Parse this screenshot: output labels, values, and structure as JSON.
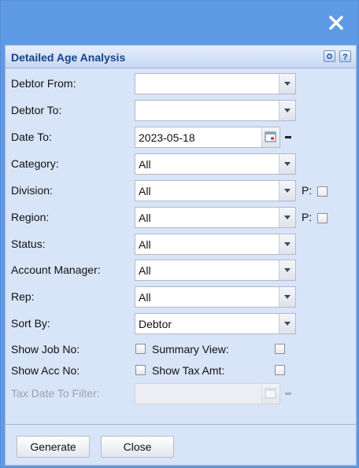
{
  "panel": {
    "title": "Detailed Age Analysis"
  },
  "fields": {
    "debtor_from": {
      "label": "Debtor From:",
      "value": ""
    },
    "debtor_to": {
      "label": "Debtor To:",
      "value": ""
    },
    "date_to": {
      "label": "Date To:",
      "value": "2023-05-18"
    },
    "category": {
      "label": "Category:",
      "value": "All"
    },
    "division": {
      "label": "Division:",
      "value": "All",
      "p_label": "P:"
    },
    "region": {
      "label": "Region:",
      "value": "All",
      "p_label": "P:"
    },
    "status": {
      "label": "Status:",
      "value": "All"
    },
    "account_manager": {
      "label": "Account Manager:",
      "value": "All"
    },
    "rep": {
      "label": "Rep:",
      "value": "All"
    },
    "sort_by": {
      "label": "Sort By:",
      "value": "Debtor"
    },
    "show_job_no": {
      "label": "Show Job No:",
      "checked": false
    },
    "summary_view": {
      "label": "Summary View:",
      "checked": false
    },
    "show_acc_no": {
      "label": "Show Acc No:",
      "checked": false
    },
    "show_tax_amt": {
      "label": "Show Tax Amt:",
      "checked": false
    },
    "tax_date_to_filter": {
      "label": "Tax Date To Filter:",
      "value": "",
      "disabled": true
    }
  },
  "buttons": {
    "generate": "Generate",
    "close": "Close"
  },
  "icons": {
    "close": "close-icon",
    "settings": "gear-icon",
    "help": "help-icon",
    "calendar": "calendar-icon",
    "clear": "minus-icon",
    "dropdown": "chevron-down-icon"
  },
  "colors": {
    "titlebar": "#5e9ae6",
    "panel": "#d8e4f7",
    "header_text": "#15428b"
  }
}
